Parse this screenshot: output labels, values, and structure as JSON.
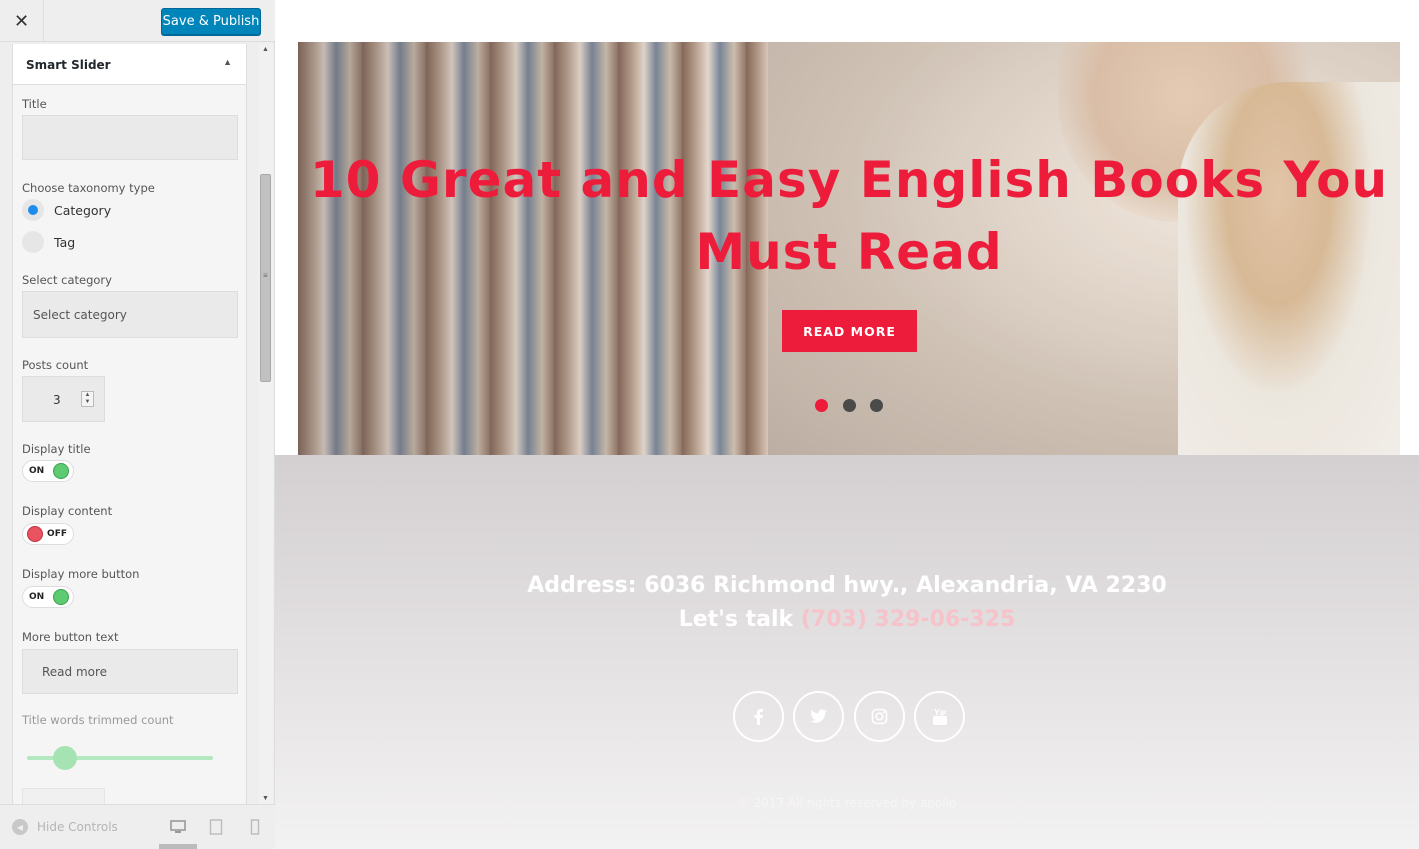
{
  "toolbar": {
    "close_icon": "close-icon",
    "save_label": "Save & Publish"
  },
  "section": {
    "title": "Smart Slider",
    "collapse_icon": "triangle-up-icon"
  },
  "fields": {
    "title_label": "Title",
    "title_value": "",
    "taxonomy_label": "Choose taxonomy type",
    "taxonomy_options": [
      "Category",
      "Tag"
    ],
    "taxonomy_selected": "Category",
    "category_label": "Select category",
    "category_value": "Select category",
    "posts_count_label": "Posts count",
    "posts_count_value": "3",
    "display_title_label": "Display title",
    "display_title_state": "ON",
    "display_content_label": "Display content",
    "display_content_state": "OFF",
    "display_more_label": "Display more button",
    "display_more_state": "ON",
    "more_text_label": "More button text",
    "more_text_value": "Read more",
    "trim_label": "Title words trimmed count",
    "trim_slider_level": 0.2
  },
  "footer_bar": {
    "hide_controls_label": "Hide Controls",
    "devices": [
      "desktop-icon",
      "tablet-icon",
      "mobile-icon"
    ],
    "active_device": "desktop"
  },
  "preview": {
    "slide_title": "10 Great and Easy English Books You Must Read",
    "read_more_label": "READ MORE",
    "dots_count": 3,
    "active_dot": 0,
    "address": "Address: 6036 Richmond hwy., Alexandria, VA 2230",
    "talk_prefix": "Let's talk",
    "phone": "(703) 329-06-325",
    "social_icons": [
      "facebook-icon",
      "twitter-icon",
      "instagram-icon",
      "youtube-icon"
    ],
    "copyright": "© 2017 All rights reserved by apollo"
  },
  "colors": {
    "accent": "#ee1c3b",
    "primary_button": "#0085ba",
    "toggle_on": "#5ecb72",
    "toggle_off": "#e9525f",
    "radio_checked": "#1e8cea"
  }
}
